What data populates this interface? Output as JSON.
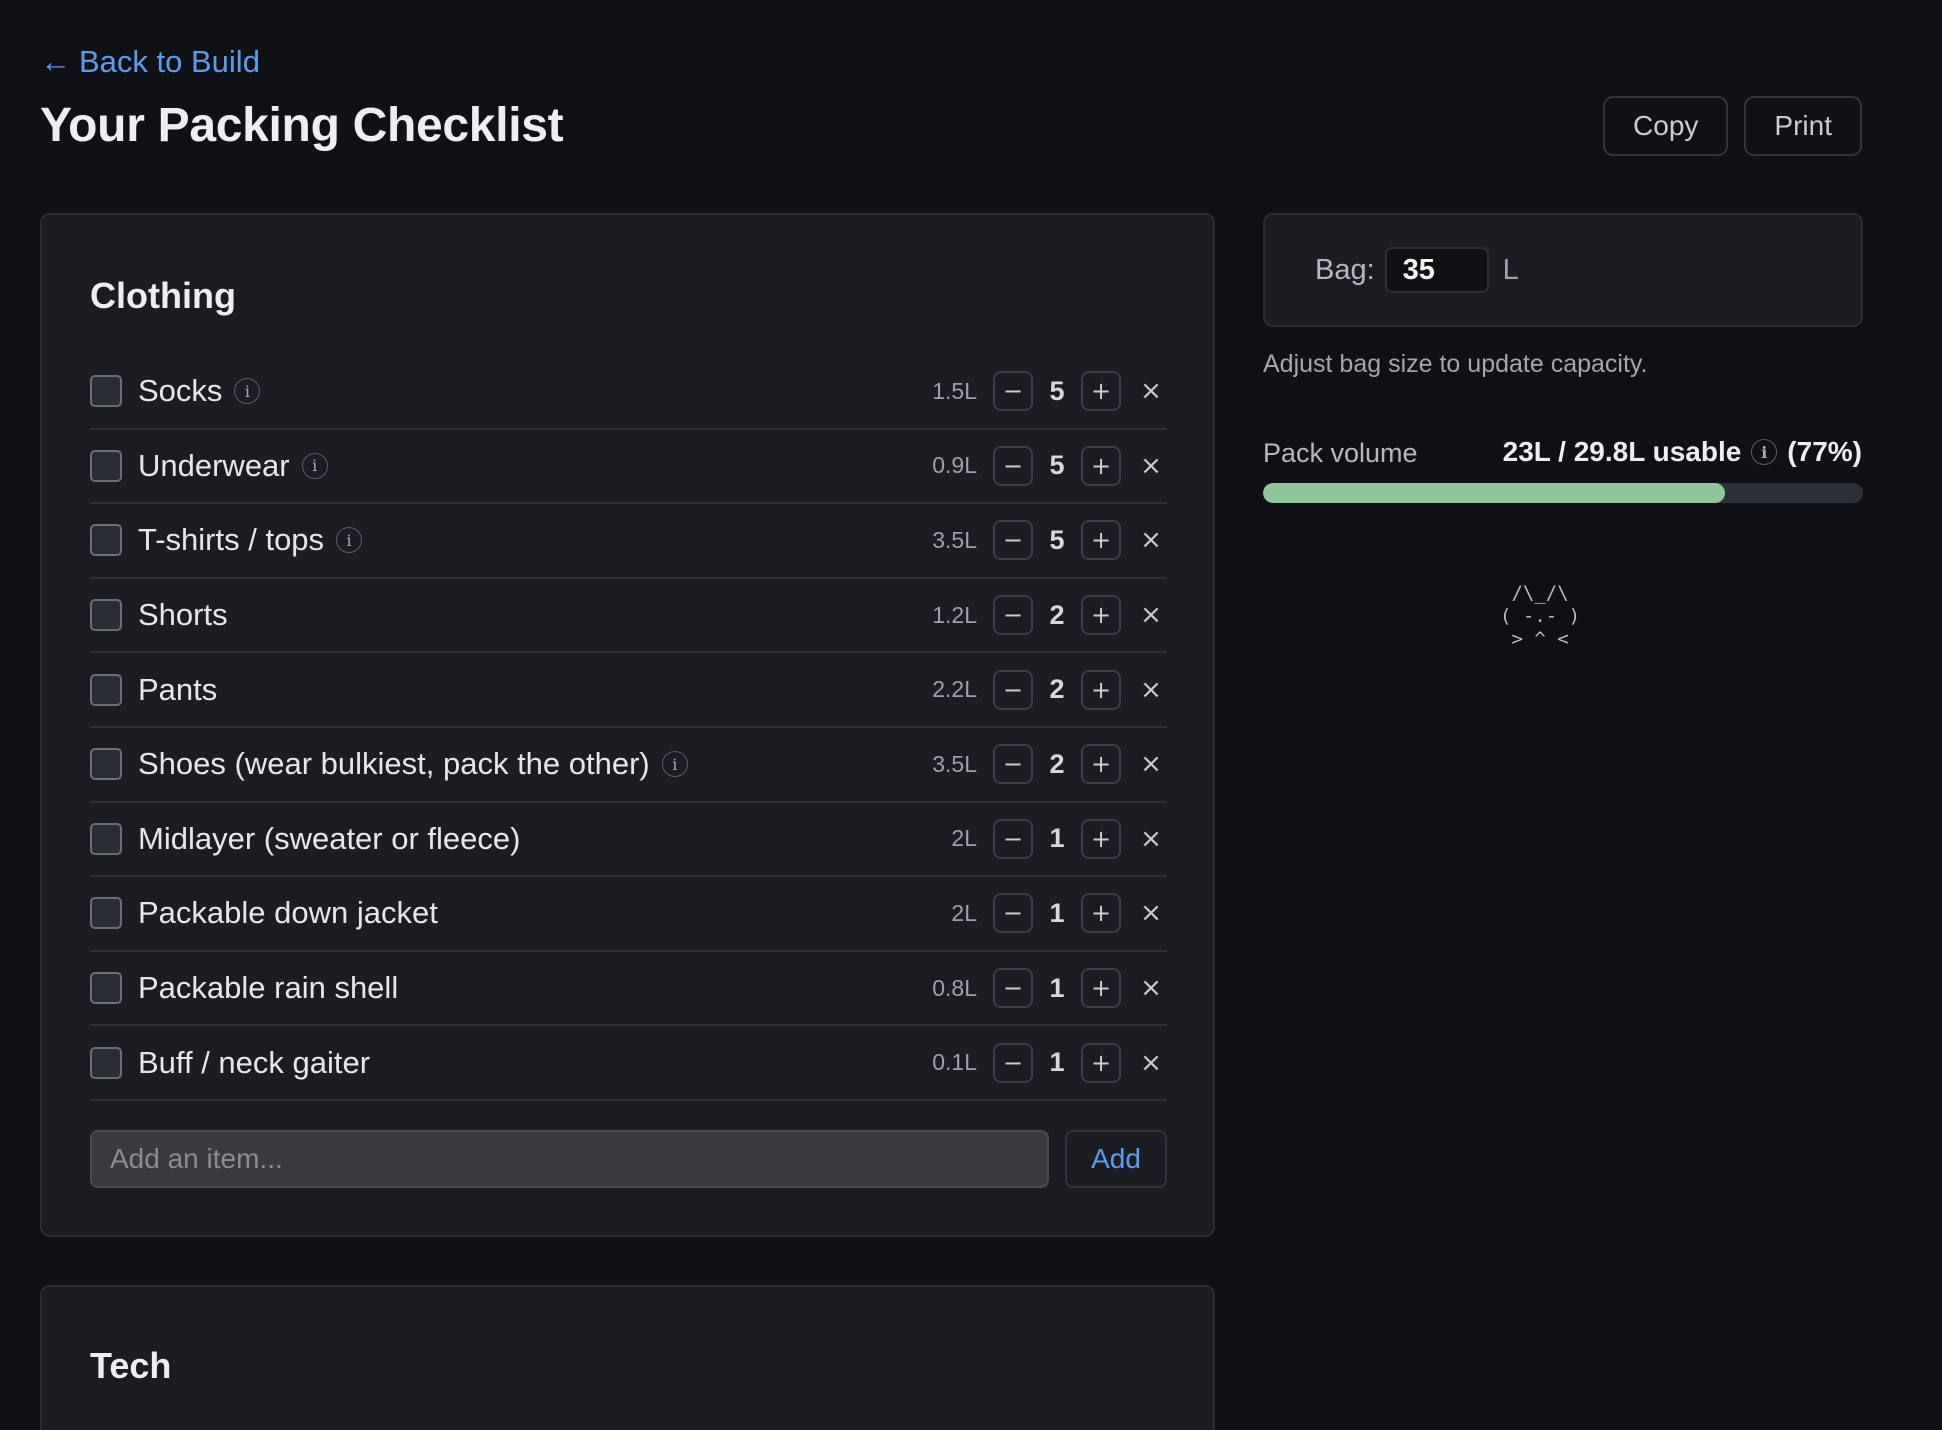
{
  "header": {
    "back_arrow": "←",
    "back_label": "Back to Build",
    "title": "Your Packing Checklist",
    "copy_label": "Copy",
    "print_label": "Print"
  },
  "clothing": {
    "title": "Clothing",
    "items": [
      {
        "name": "Socks",
        "info": true,
        "volume": "1.5L",
        "qty": "5"
      },
      {
        "name": "Underwear",
        "info": true,
        "volume": "0.9L",
        "qty": "5"
      },
      {
        "name": "T-shirts / tops",
        "info": true,
        "volume": "3.5L",
        "qty": "5"
      },
      {
        "name": "Shorts",
        "info": false,
        "volume": "1.2L",
        "qty": "2"
      },
      {
        "name": "Pants",
        "info": false,
        "volume": "2.2L",
        "qty": "2"
      },
      {
        "name": "Shoes (wear bulkiest, pack the other)",
        "info": true,
        "volume": "3.5L",
        "qty": "2"
      },
      {
        "name": "Midlayer (sweater or fleece)",
        "info": false,
        "volume": "2L",
        "qty": "1"
      },
      {
        "name": "Packable down jacket",
        "info": false,
        "volume": "2L",
        "qty": "1"
      },
      {
        "name": "Packable rain shell",
        "info": false,
        "volume": "0.8L",
        "qty": "1"
      },
      {
        "name": "Buff / neck gaiter",
        "info": false,
        "volume": "0.1L",
        "qty": "1"
      }
    ],
    "add_placeholder": "Add an item...",
    "add_label": "Add"
  },
  "tech": {
    "title": "Tech"
  },
  "controls": {
    "minus": "−",
    "plus": "+",
    "remove": "×",
    "info": "i"
  },
  "bag": {
    "label": "Bag:",
    "value": "35",
    "unit": "L",
    "hint": "Adjust bag size to update capacity."
  },
  "pack_volume": {
    "label": "Pack volume",
    "summary": "23L / 29.8L usable",
    "percent_text": "(77%)",
    "fill_fraction": 0.77,
    "fill_color": "#8ec59a"
  },
  "ascii_art": " /\\_/\\\n( -.- )\n > ^ <"
}
